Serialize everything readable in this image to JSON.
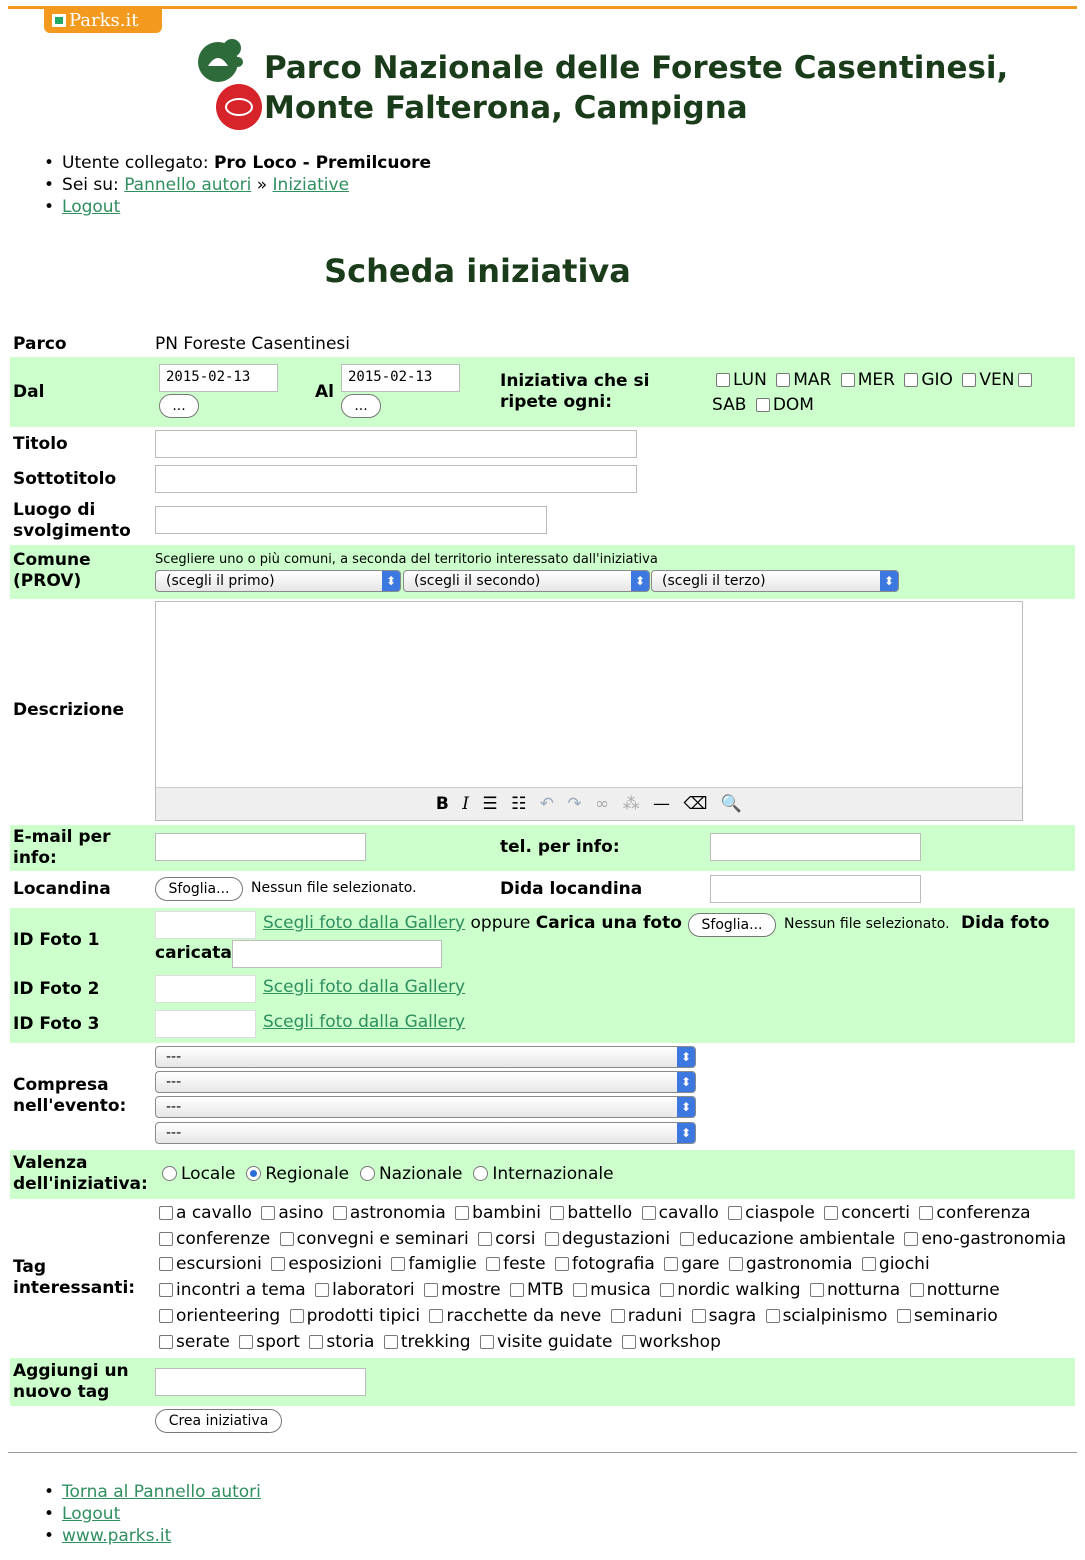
{
  "site_tab": "Parks.it",
  "park": {
    "title_line1": "Parco Nazionale delle Foreste Casentinesi,",
    "title_line2": "Monte Falterona, Campigna"
  },
  "nav": {
    "user_label": "Utente collegato:",
    "user_name": "Pro Loco - Premilcuore",
    "where_label": "Sei su:",
    "crumb1": "Pannello autori",
    "sep": "»",
    "crumb2": "Iniziative",
    "logout": "Logout"
  },
  "page_title": "Scheda iniziativa",
  "form": {
    "parco_label": "Parco",
    "parco_value": "PN Foreste Casentinesi",
    "dal_label": "Dal",
    "dal_value": "2015-02-13",
    "al_label": "Al",
    "al_value": "2015-02-13",
    "date_btn": "...",
    "repeat_label_1": "Iniziativa che si",
    "repeat_label_2": "ripete ogni:",
    "days": [
      "LUN",
      "MAR",
      "MER",
      "GIO",
      "VEN",
      "SAB",
      "DOM"
    ],
    "titolo_label": "Titolo",
    "sottotitolo_label": "Sottotitolo",
    "luogo_label_1": "Luogo di",
    "luogo_label_2": "svolgimento",
    "comune_label_1": "Comune",
    "comune_label_2": "(PROV)",
    "comune_hint": "Scegliere uno o più comuni, a seconda del territorio interessato dall'iniziativa",
    "comune_selects": [
      "(scegli il primo)",
      "(scegli il secondo)",
      "(scegli il terzo)"
    ],
    "descrizione_label": "Descrizione",
    "editor_tools": [
      "B",
      "I",
      "☰",
      "☷",
      "↶",
      "↷",
      "∞",
      "⁂",
      "—",
      "⌫",
      "🔍"
    ],
    "email_label_1": "E-mail per",
    "email_label_2": "info:",
    "tel_label": "tel. per info:",
    "locandina_label": "Locandina",
    "browse_btn": "Sfoglia...",
    "no_file": "Nessun file selezionato.",
    "dida_locandina_label": "Dida locandina",
    "foto1_label": "ID Foto 1",
    "foto2_label": "ID Foto 2",
    "foto3_label": "ID Foto 3",
    "gallery_link": "Scegli foto dalla Gallery",
    "oppure": "oppure",
    "carica": "Carica una foto",
    "dida_foto": "Dida foto",
    "caricata": "caricata",
    "compresa_label_1": "Compresa",
    "compresa_label_2": "nell'evento:",
    "compresa_selects": [
      "---",
      "---",
      "---",
      "---"
    ],
    "valenza_label_1": "Valenza",
    "valenza_label_2": "dell'iniziativa:",
    "valenza_options": [
      "Locale",
      "Regionale",
      "Nazionale",
      "Internazionale"
    ],
    "valenza_selected": "Regionale",
    "tag_label_1": "Tag",
    "tag_label_2": "interessanti:",
    "tags": [
      "a cavallo",
      "asino",
      "astronomia",
      "bambini",
      "battello",
      "cavallo",
      "ciaspole",
      "concerti",
      "conferenza",
      "conferenze",
      "convegni e seminari",
      "corsi",
      "degustazioni",
      "educazione ambientale",
      "eno-gastronomia",
      "escursioni",
      "esposizioni",
      "famiglie",
      "feste",
      "fotografia",
      "gare",
      "gastronomia",
      "giochi",
      "incontri a tema",
      "laboratori",
      "mostre",
      "MTB",
      "musica",
      "nordic walking",
      "notturna",
      "notturne",
      "orienteering",
      "prodotti tipici",
      "racchette da neve",
      "raduni",
      "sagra",
      "scialpinismo",
      "seminario",
      "serate",
      "sport",
      "storia",
      "trekking",
      "visite guidate",
      "workshop"
    ],
    "newtag_label_1": "Aggiungi un",
    "newtag_label_2": "nuovo tag",
    "submit": "Crea iniziativa"
  },
  "footer": {
    "links": [
      "Torna al Pannello autori",
      "Logout",
      "www.parks.it"
    ]
  },
  "colors": {
    "accent": "#f39a1e",
    "row_green": "#ccffcc",
    "link": "#2f8f5f",
    "title": "#1a3c1a"
  }
}
